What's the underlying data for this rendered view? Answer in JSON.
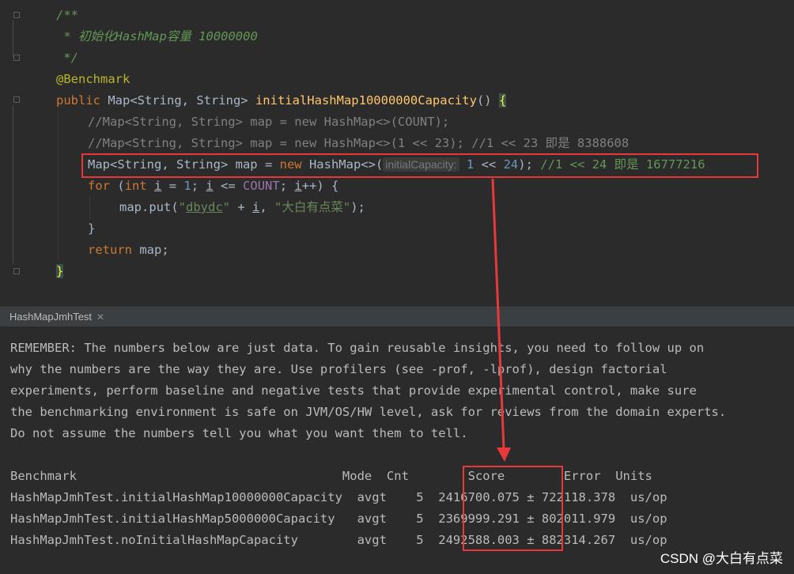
{
  "editor": {
    "lines": {
      "doc_open": "/**",
      "doc_body": " * 初始化HashMap容量 10000000",
      "doc_close": " */",
      "annotation": "@Benchmark",
      "sig_kw": "public",
      "sig_type": " Map<String, String> ",
      "sig_name": "initialHashMap10000000Capacity",
      "sig_paren": "() ",
      "sig_brace": "{",
      "c1": "//Map<String, String> map = new HashMap<>(COUNT);",
      "c2": "//Map<String, String> map = new HashMap<>(1 << 23); //1 << 23 即是 8388608",
      "l3_a": "Map<String, String> map = ",
      "l3_new": "new",
      "l3_b": " HashMap<>(",
      "l3_hint": "initialCapacity:",
      "l3_n1": "1",
      "l3_c": " << ",
      "l3_n2": "24",
      "l3_d": "); ",
      "l3_cmt": "//1 << 24 即是 16777216",
      "for_kw": "for",
      "for_a": " (",
      "for_int": "int",
      "for_i1": "i",
      "for_b": " = ",
      "for_one": "1",
      "for_c": "; ",
      "for_i2": "i",
      "for_d": " <= ",
      "for_count": "COUNT",
      "for_e": "; ",
      "for_i3": "i",
      "for_f": "++) {",
      "put_a": "map.put(",
      "put_s1q": "\"",
      "put_s1": "dbydc",
      "put_s1q2": "\"",
      "put_b": " + ",
      "put_i": "i",
      "put_c": ", ",
      "put_s2": "\"大白有点菜\"",
      "put_d": ");",
      "close_inner": "}",
      "ret_kw": "return",
      "ret_rest": " map;",
      "close_outer": "}"
    }
  },
  "tab": {
    "label": "HashMapJmhTest",
    "close": "✕"
  },
  "console": {
    "remember": [
      "REMEMBER: The numbers below are just data. To gain reusable insights, you need to follow up on",
      "why the numbers are the way they are. Use profilers (see -prof, -lprof), design factorial",
      "experiments, perform baseline and negative tests that provide experimental control, make sure",
      "the benchmarking environment is safe on JVM/OS/HW level, ask for reviews from the domain experts.",
      "Do not assume the numbers tell you what you want them to tell."
    ],
    "header": "Benchmark                                    Mode  Cnt        Score        Error  Units",
    "rows": [
      "HashMapJmhTest.initialHashMap10000000Capacity  avgt    5  2416700.075 ± 722118.378  us/op",
      "HashMapJmhTest.initialHashMap5000000Capacity   avgt    5  2369999.291 ± 802011.979  us/op",
      "HashMapJmhTest.noInitialHashMapCapacity        avgt    5  2492588.003 ± 882314.267  us/op"
    ]
  },
  "watermark": "CSDN @大白有点菜",
  "colors": {
    "highlight": "#e8393a",
    "background": "#2b2b2b"
  }
}
